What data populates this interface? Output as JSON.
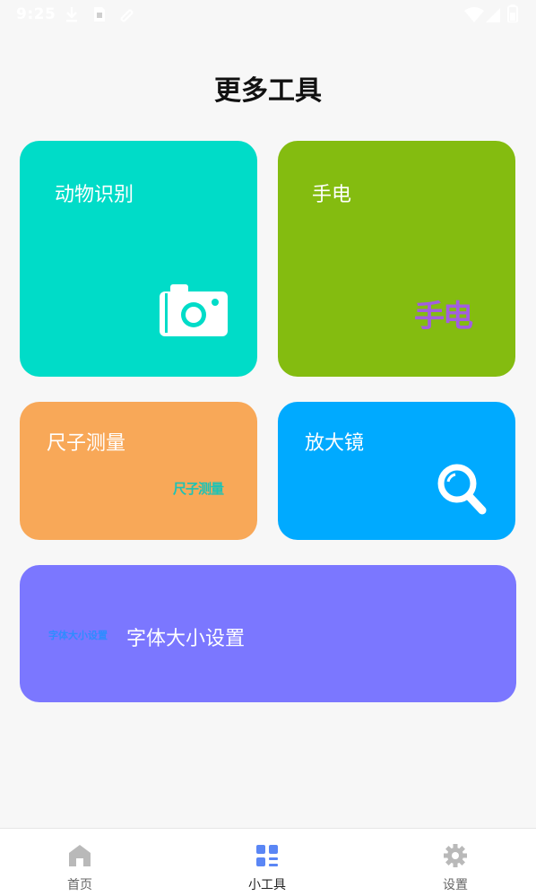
{
  "status_bar": {
    "time": "9:25",
    "left_icons": [
      "download-icon",
      "sim-icon",
      "vpn-icon"
    ],
    "right_icons": [
      "wifi-icon",
      "signal-icon",
      "battery-icon"
    ]
  },
  "page": {
    "title": "更多工具"
  },
  "cards": {
    "animal": {
      "label": "动物识别",
      "icon": "camera-icon",
      "color": "#00dcc8"
    },
    "torch": {
      "label": "手电",
      "graphic_text": "手电",
      "color": "#84bc10"
    },
    "ruler": {
      "label": "尺子测量",
      "graphic_text": "尺子测量",
      "color": "#f8a858"
    },
    "magnifier": {
      "label": "放大镜",
      "icon": "search-icon",
      "color": "#00aaff"
    },
    "font": {
      "label": "字体大小设置",
      "graphic_text": "字体大小设置",
      "color": "#7b77ff"
    }
  },
  "bottom_nav": {
    "items": [
      {
        "label": "首页",
        "icon": "home-icon",
        "active": false
      },
      {
        "label": "小工具",
        "icon": "grid-icon",
        "active": true
      },
      {
        "label": "设置",
        "icon": "gear-icon",
        "active": false
      }
    ],
    "active_color": "#5a86f5",
    "inactive_color": "#b9b9b9"
  }
}
